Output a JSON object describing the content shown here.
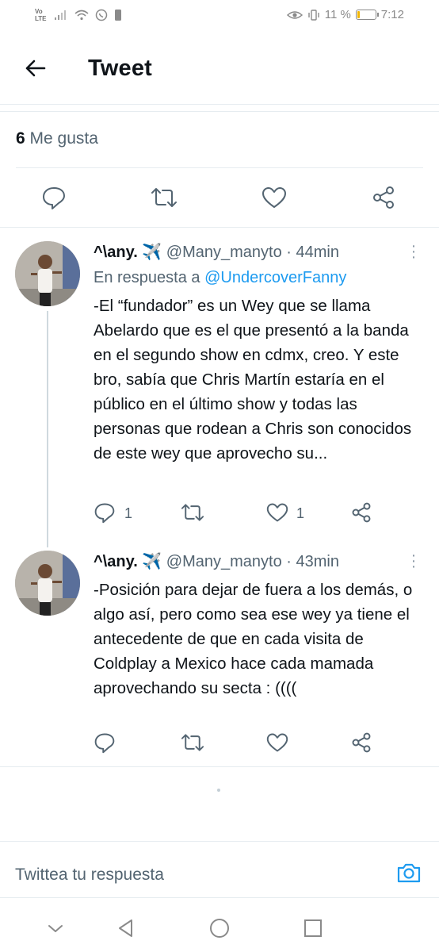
{
  "status_bar": {
    "carrier": "Vo LTE",
    "battery_percent": "11 %",
    "battery_level": 0.11,
    "time": "7:12"
  },
  "header": {
    "title": "Tweet",
    "back_icon": "arrow-left-icon"
  },
  "main_tweet": {
    "likes_count": "6",
    "likes_label": "Me gusta",
    "actions": [
      "reply-icon",
      "retweet-icon",
      "like-icon",
      "share-icon"
    ]
  },
  "replies": [
    {
      "name": "^\\any. ✈️",
      "handle": "@Many_manyto",
      "time": "· 44min",
      "reply_to_prefix": "En respuesta a",
      "reply_to_handle": "@UndercoverFanny",
      "text": "-El “fundador” es un Wey que se llama Abelardo que es el que presentó a la banda en el segundo show en cdmx, creo. Y este bro, sabía que Chris Martín estaría en el público en el último show y todas las personas que rodean a Chris son conocidos de este wey que aprovecho su...",
      "reply_count": "1",
      "retweet_count": "",
      "like_count": "1"
    },
    {
      "name": "^\\any. ✈️",
      "handle": "@Many_manyto",
      "time": "· 43min",
      "text": "-Posición para dejar de fuera a los demás, o algo así, pero como sea ese wey ya tiene el antecedente de que en cada visita de Coldplay a Mexico hace cada mamada aprovechando su secta : ((((",
      "reply_count": "",
      "retweet_count": "",
      "like_count": ""
    }
  ],
  "composer": {
    "placeholder": "Twittea tu respuesta"
  },
  "colors": {
    "accent": "#1d9bf0",
    "text": "#0f1419",
    "secondary": "#536471",
    "divider": "#e6ecf0"
  }
}
